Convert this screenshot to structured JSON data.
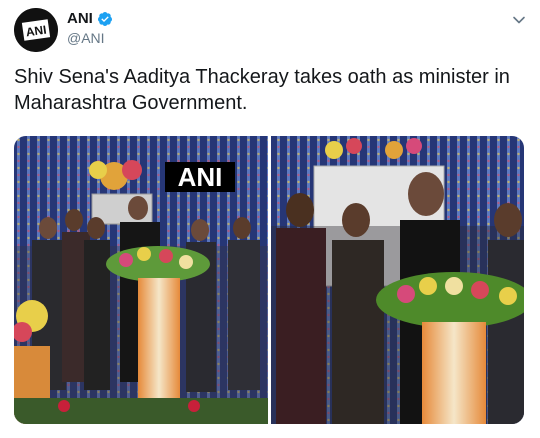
{
  "account": {
    "display_name": "ANI",
    "handle": "@ANI",
    "avatar_text": "ANI",
    "verified": true
  },
  "tweet": {
    "text": "Shiv Sena's Aaditya Thackeray takes oath as minister in Maharashtra Government."
  },
  "media": {
    "watermark": "ANI"
  },
  "icons": {
    "verified": "verified-badge-icon",
    "more": "chevron-down-icon"
  },
  "colors": {
    "verified_blue": "#1da1f2",
    "handle_gray": "#657786"
  }
}
